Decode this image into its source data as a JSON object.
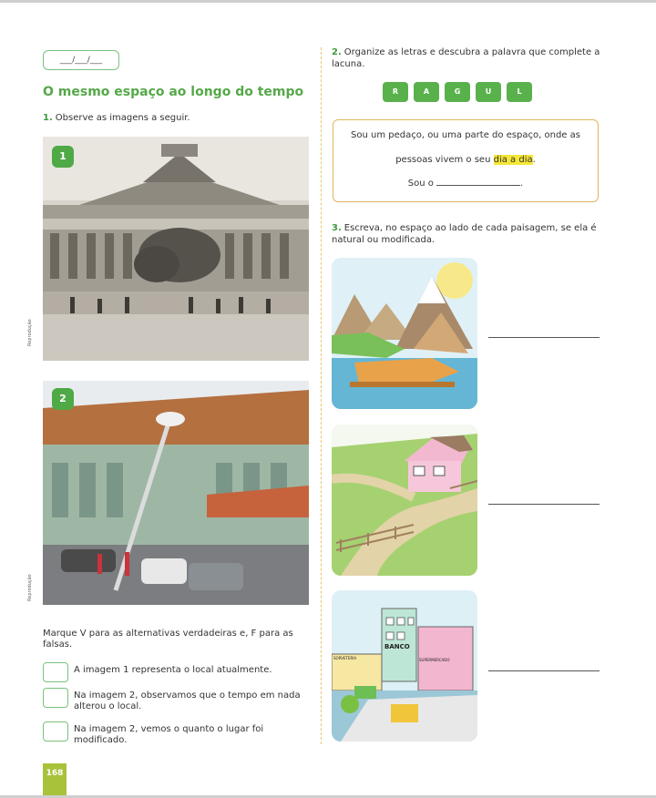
{
  "header": {
    "date_placeholder": "___/___/___"
  },
  "left": {
    "title": "O mesmo espaço ao longo do tempo",
    "q1_number": "1.",
    "q1_text": "Observe as imagens a seguir.",
    "image1_label": "1",
    "image2_label": "2",
    "credit": "Reprodução",
    "true_false_instructions": "Marque V para as alternativas verdadeiras e, F para as falsas.",
    "options": [
      "A imagem 1 representa o local atualmente.",
      "Na imagem 2, observamos que o tempo em nada alterou o local.",
      "Na imagem 2, vemos o quanto o lugar foi modificado."
    ]
  },
  "right": {
    "q2_number": "2.",
    "q2_text": "Organize as letras e descubra a palavra que complete a lacuna.",
    "letters": [
      "R",
      "A",
      "G",
      "U",
      "L"
    ],
    "riddle_line1": "Sou um pedaço, ou uma parte do espaço, onde as",
    "riddle_line2_before": "pessoas vivem o seu ",
    "riddle_highlight": "dia a dia",
    "riddle_line2_after": ".",
    "riddle_line3": "Sou o",
    "q3_number": "3.",
    "q3_text": "Escreva, no espaço ao lado de cada paisagem, se ela é natural ou modificada.",
    "city_signs": [
      "BANCO",
      "SORVETERIA",
      "SUPERMERCADO"
    ]
  },
  "footer": {
    "page_number": "168"
  }
}
